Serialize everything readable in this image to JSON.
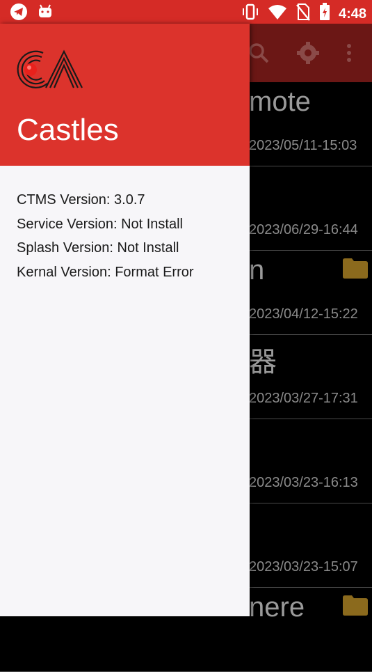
{
  "status_bar": {
    "time": "4:48",
    "icons": [
      "telegram-icon",
      "android-icon",
      "vibrate-icon",
      "wifi-icon",
      "no-sim-icon",
      "battery-charging-icon"
    ]
  },
  "background_app": {
    "toolbar_icons": [
      "search-icon",
      "gear-icon",
      "overflow-menu-icon"
    ],
    "rows": [
      {
        "title": "mote",
        "date": "2023/05/11-15:03",
        "folder": false
      },
      {
        "title": "",
        "date": "2023/06/29-16:44",
        "folder": false
      },
      {
        "title": "n",
        "date": "2023/04/12-15:22",
        "folder": true
      },
      {
        "title": "器",
        "date": "2023/03/27-17:31",
        "folder": false
      },
      {
        "title": "",
        "date": "2023/03/23-16:13",
        "folder": false
      },
      {
        "title": "",
        "date": "2023/03/23-15:07",
        "folder": false
      },
      {
        "title": "nere",
        "date": "",
        "folder": true
      }
    ]
  },
  "drawer": {
    "brand": "Castles",
    "info": [
      "CTMS Version: 3.0.7",
      "Service Version: Not Install",
      "Splash Version: Not Install",
      "Kernal Version: Format Error"
    ]
  },
  "colors": {
    "status_bar": "#d52b26",
    "drawer_header": "#dc332c",
    "drawer_bg": "#f7f6f9",
    "dimmed_toolbar": "#6b1715",
    "folder": "#8b6a1d"
  }
}
